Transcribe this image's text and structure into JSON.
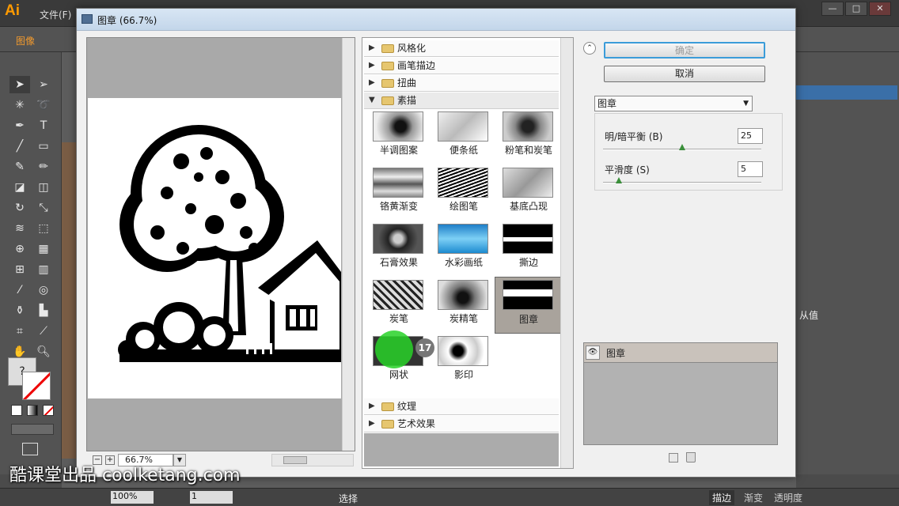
{
  "app": {
    "logo": "Ai",
    "menu_file": "文件(F)",
    "control_label": "图像",
    "window_buttons": [
      "—",
      "□",
      "✕"
    ]
  },
  "dialog": {
    "title": "图章 (66.7%)",
    "zoom_value": "66.7%",
    "zoom_minus": "−",
    "zoom_plus": "+",
    "ok_label": "确定",
    "cancel_label": "取消",
    "filter_selected": "图章",
    "params": [
      {
        "label": "明/暗平衡 (B)",
        "value": "25",
        "level": 0.5
      },
      {
        "label": "平滑度 (S)",
        "value": "5",
        "level": 0.1
      }
    ],
    "layer_name": "图章"
  },
  "gallery": {
    "categories_top": [
      {
        "label": "风格化",
        "expanded": false
      },
      {
        "label": "画笔描边",
        "expanded": false
      },
      {
        "label": "扭曲",
        "expanded": false
      },
      {
        "label": "素描",
        "expanded": true
      }
    ],
    "sketch_filters": [
      "半调图案",
      "便条纸",
      "粉笔和炭笔",
      "铬黄渐变",
      "绘图笔",
      "基底凸现",
      "石膏效果",
      "水彩画纸",
      "撕边",
      "炭笔",
      "炭精笔",
      "图章",
      "网状",
      "影印"
    ],
    "selected_filter": "图章",
    "categories_bottom": [
      {
        "label": "纹理",
        "expanded": false
      },
      {
        "label": "艺术效果",
        "expanded": false
      }
    ]
  },
  "right_panel": {
    "value_label": "从值",
    "tabs": [
      "描边",
      "渐变",
      "透明度"
    ]
  },
  "status": {
    "zoom": "100%",
    "page": "1",
    "tool": "选择"
  },
  "overlay": {
    "badge": "17",
    "watermark": "酷课堂出品 coolketang.com"
  },
  "colors": {
    "accent_orange": "#f29a2e",
    "ok_focus_border": "#3b9cd9",
    "cursor_green": "#28d228"
  }
}
